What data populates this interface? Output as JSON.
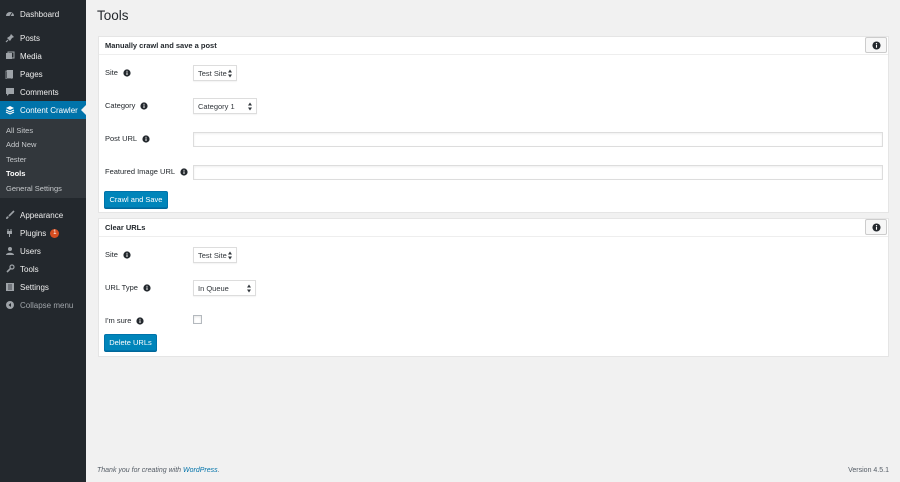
{
  "sidebar": {
    "items": [
      {
        "label": "Dashboard",
        "icon": "dashboard-icon"
      },
      {
        "label": "Posts",
        "icon": "pin-icon"
      },
      {
        "label": "Media",
        "icon": "media-icon"
      },
      {
        "label": "Pages",
        "icon": "page-icon"
      },
      {
        "label": "Comments",
        "icon": "comment-icon"
      },
      {
        "label": "Content Crawler",
        "icon": "crawler-icon"
      },
      {
        "label": "Appearance",
        "icon": "brush-icon"
      },
      {
        "label": "Plugins",
        "icon": "plugin-icon",
        "badge": "1"
      },
      {
        "label": "Users",
        "icon": "user-icon"
      },
      {
        "label": "Tools",
        "icon": "wrench-icon"
      },
      {
        "label": "Settings",
        "icon": "settings-icon"
      },
      {
        "label": "Collapse menu",
        "icon": "collapse-icon"
      }
    ],
    "submenu": [
      "All Sites",
      "Add New",
      "Tester",
      "Tools",
      "General Settings"
    ]
  },
  "page": {
    "title": "Tools"
  },
  "crawl_box": {
    "title": "Manually crawl and save a post",
    "site_label": "Site",
    "site_value": "Test Site",
    "category_label": "Category",
    "category_value": "Category 1",
    "post_url_label": "Post URL",
    "post_url_value": "",
    "featured_label": "Featured Image URL",
    "featured_value": "",
    "button": "Crawl and Save"
  },
  "clear_box": {
    "title": "Clear URLs",
    "site_label": "Site",
    "site_value": "Test Site",
    "url_type_label": "URL Type",
    "url_type_value": "In Queue",
    "sure_label": "I'm sure",
    "button": "Delete URLs"
  },
  "footer": {
    "thanks": "Thank you for creating with ",
    "wp_link": "WordPress",
    "period": ".",
    "version": "Version 4.5.1"
  },
  "colors": {
    "accent": "#0073aa",
    "button": "#0085ba",
    "sidebar": "#23282d",
    "badge": "#d54e21"
  }
}
